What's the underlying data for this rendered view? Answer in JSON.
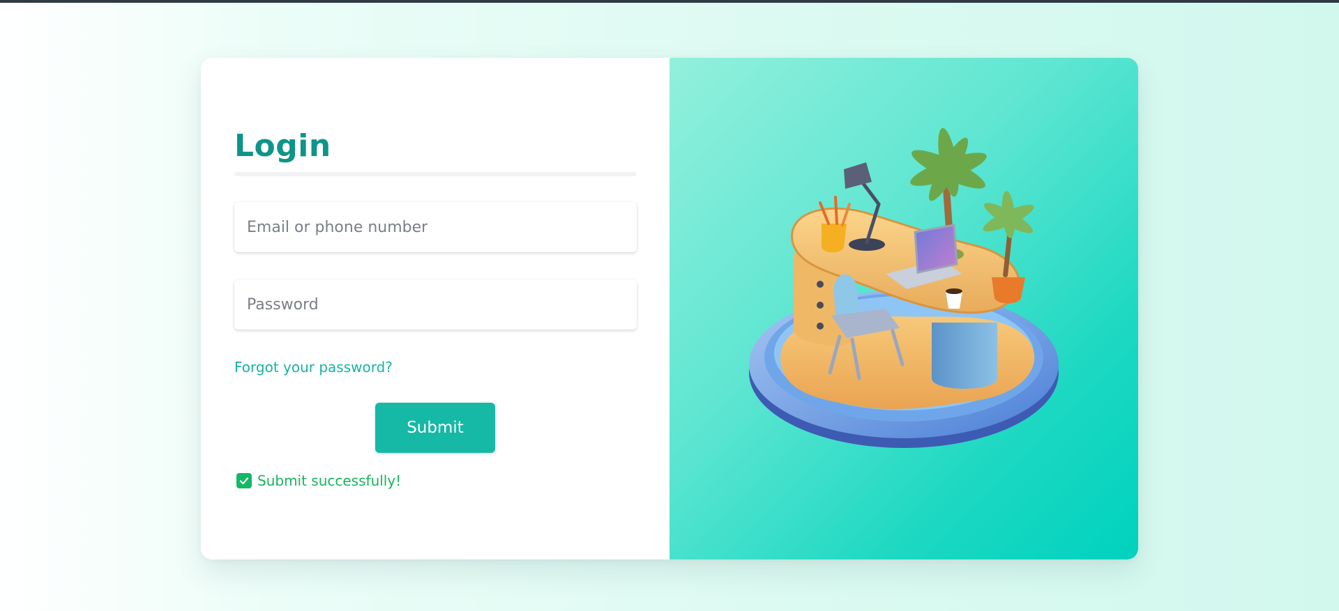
{
  "login": {
    "title": "Login",
    "email_placeholder": "Email or phone number",
    "password_placeholder": "Password",
    "forgot_password": "Forgot your password?",
    "submit_label": "Submit",
    "status_message": "Submit successfully!"
  },
  "illustration": {
    "icon": "desk-island-illustration"
  },
  "colors": {
    "accent": "#0e9488",
    "button": "#16b8a6",
    "link": "#17b3a3",
    "success": "#18b45c",
    "panel_gradient_start": "#92f0dc",
    "panel_gradient_end": "#00d2be"
  }
}
